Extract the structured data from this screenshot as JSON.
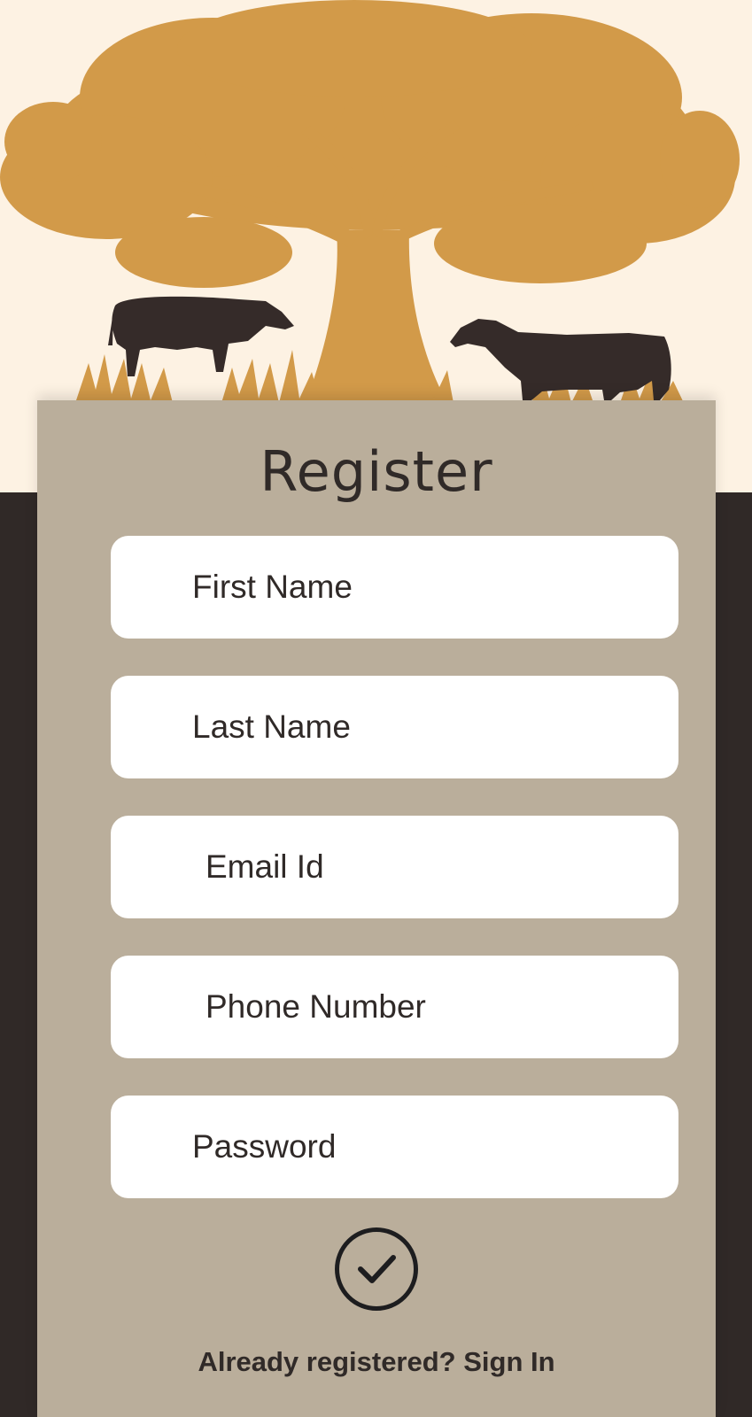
{
  "form": {
    "title": "Register",
    "fields": [
      {
        "name": "first-name",
        "placeholder": "First Name",
        "value": ""
      },
      {
        "name": "last-name",
        "placeholder": "Last Name",
        "value": ""
      },
      {
        "name": "email",
        "placeholder": "Email Id",
        "value": ""
      },
      {
        "name": "phone",
        "placeholder": "Phone Number",
        "value": ""
      },
      {
        "name": "password",
        "placeholder": "Password",
        "value": ""
      }
    ],
    "submit_icon": "checkmark-circle-icon",
    "signin_link": "Already registered? Sign In"
  },
  "colors": {
    "background_top": "#FDF2E3",
    "background_bottom": "#302927",
    "card": "#BAAE9B",
    "tree": "#D29A49",
    "cow": "#352B29",
    "text": "#302A28"
  }
}
